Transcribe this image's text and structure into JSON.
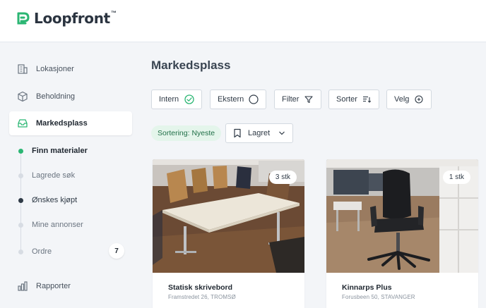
{
  "app": {
    "brand": "Loopfront",
    "trademark": "™"
  },
  "sidebar": {
    "items": [
      {
        "label": "Lokasjoner",
        "icon": "building-icon"
      },
      {
        "label": "Beholdning",
        "icon": "box-icon"
      },
      {
        "label": "Markedsplass",
        "icon": "inbox-tray-icon",
        "active": true
      }
    ],
    "sub_items": [
      {
        "label": "Finn materialer",
        "state": "active"
      },
      {
        "label": "Lagrede søk",
        "state": "normal"
      },
      {
        "label": "Ønskes kjøpt",
        "state": "emphasis"
      },
      {
        "label": "Mine annonser",
        "state": "normal"
      },
      {
        "label": "Ordre",
        "state": "normal",
        "badge": "7"
      }
    ],
    "reports": {
      "label": "Rapporter",
      "icon": "bar-chart-icon"
    }
  },
  "main": {
    "title": "Markedsplass",
    "toolbar": {
      "intern": "Intern",
      "ekstern": "Ekstern",
      "filter": "Filter",
      "sorter": "Sorter",
      "velg": "Velg"
    },
    "sort_chip": "Sortering: Nyeste",
    "saved_dropdown": "Lagret",
    "cards": [
      {
        "title": "Statisk skrivebord",
        "address": "Framstredet 26, TROMSØ",
        "qty": "3 stk"
      },
      {
        "title": "Kinnarps Plus",
        "address": "Forusbeen 50, STAVANGER",
        "qty": "1 stk"
      }
    ]
  },
  "colors": {
    "accent_green": "#2bb673",
    "chip_bg": "#e4f5eb",
    "text_dark": "#1f2730"
  }
}
